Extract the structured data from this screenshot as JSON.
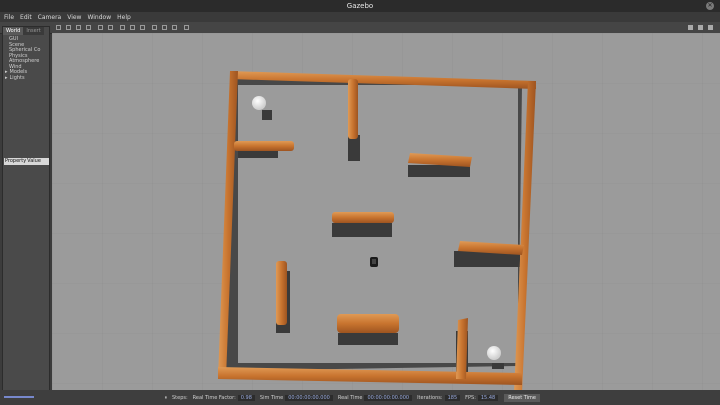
{
  "window": {
    "title": "Gazebo",
    "close_icon": "close-icon"
  },
  "menu": [
    "File",
    "Edit",
    "Camera",
    "View",
    "Window",
    "Help"
  ],
  "left_panel": {
    "tabs": [
      "World",
      "Insert"
    ],
    "tree": [
      "GUI",
      "Scene",
      "Spherical Co",
      "Physics",
      "Atmosphere",
      "Wind",
      "Models",
      "Lights"
    ],
    "property_header": [
      "Property",
      "Value"
    ]
  },
  "status": {
    "steps_label": "Steps:",
    "real_time_factor_label": "Real Time Factor:",
    "real_time_factor_value": "0.98",
    "sim_time_label": "Sim Time",
    "sim_time_value": "00:00:00:00.000",
    "real_time_label": "Real Time",
    "real_time_value": "00:00:00:00.000",
    "iterations_label": "Iterations:",
    "iterations_value": "185",
    "fps_label": "FPS:",
    "fps_value": "15.48",
    "reset_time_label": "Reset Time"
  },
  "scene": {
    "floor_color": "#9b9b9b",
    "wall_color": "#c8742f",
    "sphere_color": "#f2f2f2",
    "robot_color": "#1a1a1a"
  }
}
